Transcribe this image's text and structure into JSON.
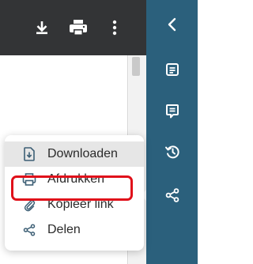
{
  "menu": {
    "items": [
      {
        "label": "Downloaden",
        "icon": "download-doc-icon",
        "hovered": true
      },
      {
        "label": "Afdrukken",
        "icon": "printer-icon",
        "hovered": false
      },
      {
        "label": "Kopieer link",
        "icon": "paperclip-icon",
        "hovered": false,
        "highlighted": true
      },
      {
        "label": "Delen",
        "icon": "share-icon",
        "hovered": false
      }
    ]
  },
  "toolbar": {
    "icons": [
      "download-icon",
      "print-icon",
      "more-vertical-icon"
    ]
  },
  "side_rail": {
    "icons": [
      "chevron-left-icon",
      "document-icon",
      "comment-icon",
      "history-icon",
      "share-icon"
    ],
    "active": "share-icon"
  },
  "colors": {
    "toolbar_bg": "#333436",
    "rail_bg": "#2b607c",
    "highlight": "#e0101a",
    "hover_bg": "#e6e6e6"
  }
}
